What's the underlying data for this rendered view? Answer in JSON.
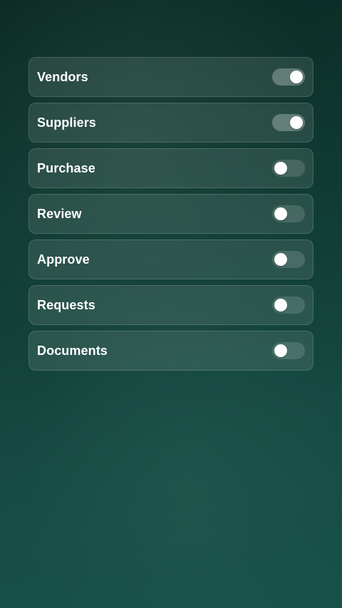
{
  "toggles": [
    {
      "label": "Vendors",
      "on": true
    },
    {
      "label": "Suppliers",
      "on": true
    },
    {
      "label": "Purchase",
      "on": false
    },
    {
      "label": "Review",
      "on": false
    },
    {
      "label": "Approve",
      "on": false
    },
    {
      "label": "Requests",
      "on": false
    },
    {
      "label": "Documents",
      "on": false
    }
  ]
}
